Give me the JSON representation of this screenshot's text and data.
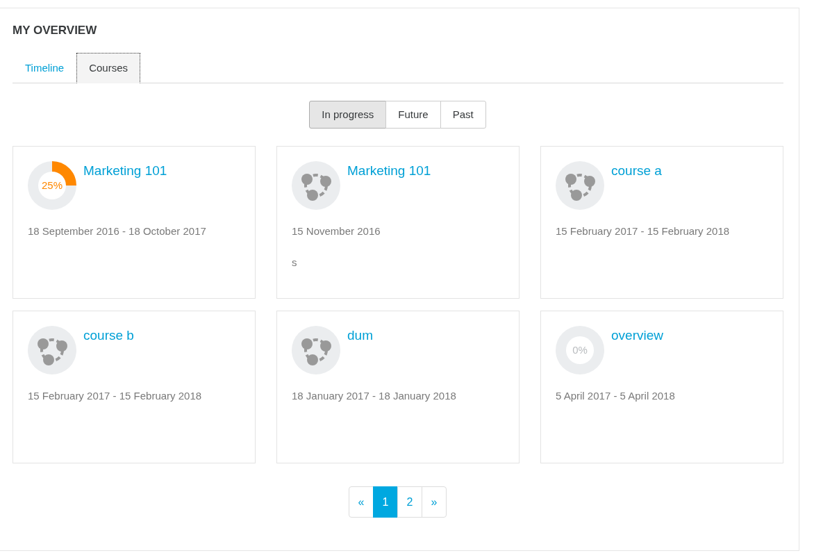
{
  "title": "MY OVERVIEW",
  "tabs": [
    {
      "label": "Timeline",
      "selected": false
    },
    {
      "label": "Courses",
      "selected": true
    }
  ],
  "filters": [
    {
      "label": "In progress",
      "selected": true
    },
    {
      "label": "Future",
      "selected": false
    },
    {
      "label": "Past",
      "selected": false
    }
  ],
  "courses": [
    {
      "kind": "progress",
      "name": "Marketing 101",
      "level": 0.25,
      "progress": "25%",
      "dates": "18 September 2016 - 18 October 2017"
    },
    {
      "kind": "icon",
      "name": "Marketing 101",
      "dates": "15 November 2016",
      "summary": "s"
    },
    {
      "kind": "icon",
      "name": "course a",
      "dates": "15 February 2017 - 15 February 2018"
    },
    {
      "kind": "icon",
      "name": "course b",
      "dates": "15 February 2017 - 15 February 2018"
    },
    {
      "kind": "icon",
      "name": "dum",
      "dates": "18 January 2017 - 18 January 2018"
    },
    {
      "kind": "progress",
      "name": "overview",
      "level": 0,
      "progress": "0%",
      "dates": "5 April 2017 - 5 April 2018"
    }
  ],
  "pagination": [
    {
      "label": "«",
      "selected": false
    },
    {
      "label": "1",
      "selected": true
    },
    {
      "label": "2",
      "selected": false
    },
    {
      "label": "»",
      "selected": false
    }
  ]
}
